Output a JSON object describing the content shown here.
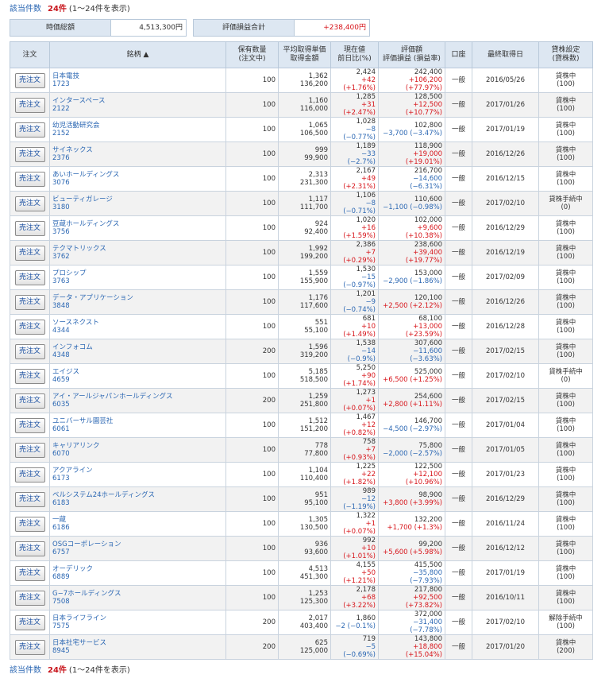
{
  "count": {
    "label": "該当件数",
    "number": "24件",
    "range": "(1～24件を表示)"
  },
  "summary": {
    "market_label": "時価総額",
    "market_value": "4,513,300円",
    "pl_label": "評価損益合計",
    "pl_value": "+238,400円"
  },
  "headers": {
    "order": "注文",
    "name": "銘柄 ▲",
    "qty": [
      "保有数量",
      "(注文中)"
    ],
    "avg": [
      "平均取得単価",
      "取得金額"
    ],
    "cur": [
      "現在値",
      "前日比(%)"
    ],
    "val": [
      "評価額",
      "評価損益 (損益率)"
    ],
    "acct": "口座",
    "date": "最終取得日",
    "lend": [
      "貸株設定",
      "(貸株数)"
    ]
  },
  "order_button_label": "売注文",
  "rows": [
    {
      "name": "日本電技",
      "code": "1723",
      "qty": "100",
      "avg": "1,362",
      "cost": "136,200",
      "price": "2,424",
      "chg": "+42 (+1.76%)",
      "val": "242,400",
      "pl": "+106,200 (+77.97%)",
      "acct": "一般",
      "date": "2016/05/26",
      "lend": "貸株中",
      "lendn": "(100)"
    },
    {
      "name": "インタースペース",
      "code": "2122",
      "qty": "100",
      "avg": "1,160",
      "cost": "116,000",
      "price": "1,285",
      "chg": "+31 (+2.47%)",
      "val": "128,500",
      "pl": "+12,500 (+10.77%)",
      "acct": "一般",
      "date": "2017/01/26",
      "lend": "貸株中",
      "lendn": "(100)"
    },
    {
      "name": "幼児活動研究会",
      "code": "2152",
      "qty": "100",
      "avg": "1,065",
      "cost": "106,500",
      "price": "1,028",
      "chg": "−8 (−0.77%)",
      "val": "102,800",
      "pl": "−3,700 (−3.47%)",
      "acct": "一般",
      "date": "2017/01/19",
      "lend": "貸株中",
      "lendn": "(100)"
    },
    {
      "name": "サイネックス",
      "code": "2376",
      "qty": "100",
      "avg": "999",
      "cost": "99,900",
      "price": "1,189",
      "chg": "−33 (−2.7%)",
      "val": "118,900",
      "pl": "+19,000 (+19.01%)",
      "acct": "一般",
      "date": "2016/12/26",
      "lend": "貸株中",
      "lendn": "(100)"
    },
    {
      "name": "あいホールディングス",
      "code": "3076",
      "qty": "100",
      "avg": "2,313",
      "cost": "231,300",
      "price": "2,167",
      "chg": "+49 (+2.31%)",
      "val": "216,700",
      "pl": "−14,600 (−6.31%)",
      "acct": "一般",
      "date": "2016/12/15",
      "lend": "貸株中",
      "lendn": "(100)"
    },
    {
      "name": "ビューティガレージ",
      "code": "3180",
      "qty": "100",
      "avg": "1,117",
      "cost": "111,700",
      "price": "1,106",
      "chg": "−8 (−0.71%)",
      "val": "110,600",
      "pl": "−1,100 (−0.98%)",
      "acct": "一般",
      "date": "2017/02/10",
      "lend": "貸株手続中",
      "lendn": "(0)"
    },
    {
      "name": "豆蔵ホールディングス",
      "code": "3756",
      "qty": "100",
      "avg": "924",
      "cost": "92,400",
      "price": "1,020",
      "chg": "+16 (+1.59%)",
      "val": "102,000",
      "pl": "+9,600 (+10.38%)",
      "acct": "一般",
      "date": "2016/12/29",
      "lend": "貸株中",
      "lendn": "(100)"
    },
    {
      "name": "テクマトリックス",
      "code": "3762",
      "qty": "100",
      "avg": "1,992",
      "cost": "199,200",
      "price": "2,386",
      "chg": "+7 (+0.29%)",
      "val": "238,600",
      "pl": "+39,400 (+19.77%)",
      "acct": "一般",
      "date": "2016/12/19",
      "lend": "貸株中",
      "lendn": "(100)"
    },
    {
      "name": "プロシップ",
      "code": "3763",
      "qty": "100",
      "avg": "1,559",
      "cost": "155,900",
      "price": "1,530",
      "chg": "−15 (−0.97%)",
      "val": "153,000",
      "pl": "−2,900 (−1.86%)",
      "acct": "一般",
      "date": "2017/02/09",
      "lend": "貸株中",
      "lendn": "(100)"
    },
    {
      "name": "データ・アプリケーション",
      "code": "3848",
      "qty": "100",
      "avg": "1,176",
      "cost": "117,600",
      "price": "1,201",
      "chg": "−9 (−0.74%)",
      "val": "120,100",
      "pl": "+2,500 (+2.12%)",
      "acct": "一般",
      "date": "2016/12/26",
      "lend": "貸株中",
      "lendn": "(100)"
    },
    {
      "name": "ソースネクスト",
      "code": "4344",
      "qty": "100",
      "avg": "551",
      "cost": "55,100",
      "price": "681",
      "chg": "+10 (+1.49%)",
      "val": "68,100",
      "pl": "+13,000 (+23.59%)",
      "acct": "一般",
      "date": "2016/12/28",
      "lend": "貸株中",
      "lendn": "(100)"
    },
    {
      "name": "インフォコム",
      "code": "4348",
      "qty": "200",
      "avg": "1,596",
      "cost": "319,200",
      "price": "1,538",
      "chg": "−14 (−0.9%)",
      "val": "307,600",
      "pl": "−11,600 (−3.63%)",
      "acct": "一般",
      "date": "2017/02/15",
      "lend": "貸株中",
      "lendn": "(100)"
    },
    {
      "name": "エイジス",
      "code": "4659",
      "qty": "100",
      "avg": "5,185",
      "cost": "518,500",
      "price": "5,250",
      "chg": "+90 (+1.74%)",
      "val": "525,000",
      "pl": "+6,500 (+1.25%)",
      "acct": "一般",
      "date": "2017/02/10",
      "lend": "貸株手続中",
      "lendn": "(0)"
    },
    {
      "name": "アイ・アールジャパンホールディングス",
      "code": "6035",
      "qty": "200",
      "avg": "1,259",
      "cost": "251,800",
      "price": "1,273",
      "chg": "+1 (+0.07%)",
      "val": "254,600",
      "pl": "+2,800 (+1.11%)",
      "acct": "一般",
      "date": "2017/02/15",
      "lend": "貸株中",
      "lendn": "(100)"
    },
    {
      "name": "ユニバーサル園芸社",
      "code": "6061",
      "qty": "100",
      "avg": "1,512",
      "cost": "151,200",
      "price": "1,467",
      "chg": "+12 (+0.82%)",
      "val": "146,700",
      "pl": "−4,500 (−2.97%)",
      "acct": "一般",
      "date": "2017/01/04",
      "lend": "貸株中",
      "lendn": "(100)"
    },
    {
      "name": "キャリアリンク",
      "code": "6070",
      "qty": "100",
      "avg": "778",
      "cost": "77,800",
      "price": "758",
      "chg": "+7 (+0.93%)",
      "val": "75,800",
      "pl": "−2,000 (−2.57%)",
      "acct": "一般",
      "date": "2017/01/05",
      "lend": "貸株中",
      "lendn": "(100)"
    },
    {
      "name": "アクアライン",
      "code": "6173",
      "qty": "100",
      "avg": "1,104",
      "cost": "110,400",
      "price": "1,225",
      "chg": "+22 (+1.82%)",
      "val": "122,500",
      "pl": "+12,100 (+10.96%)",
      "acct": "一般",
      "date": "2017/01/23",
      "lend": "貸株中",
      "lendn": "(100)"
    },
    {
      "name": "ベルシステム24ホールディングス",
      "code": "6183",
      "qty": "100",
      "avg": "951",
      "cost": "95,100",
      "price": "989",
      "chg": "−12 (−1.19%)",
      "val": "98,900",
      "pl": "+3,800 (+3.99%)",
      "acct": "一般",
      "date": "2016/12/29",
      "lend": "貸株中",
      "lendn": "(100)"
    },
    {
      "name": "一蔵",
      "code": "6186",
      "qty": "100",
      "avg": "1,305",
      "cost": "130,500",
      "price": "1,322",
      "chg": "+1 (+0.07%)",
      "val": "132,200",
      "pl": "+1,700 (+1.3%)",
      "acct": "一般",
      "date": "2016/11/24",
      "lend": "貸株中",
      "lendn": "(100)"
    },
    {
      "name": "OSGコーポレーション",
      "code": "6757",
      "qty": "100",
      "avg": "936",
      "cost": "93,600",
      "price": "992",
      "chg": "+10 (+1.01%)",
      "val": "99,200",
      "pl": "+5,600 (+5.98%)",
      "acct": "一般",
      "date": "2016/12/12",
      "lend": "貸株中",
      "lendn": "(100)"
    },
    {
      "name": "オーデリック",
      "code": "6889",
      "qty": "100",
      "avg": "4,513",
      "cost": "451,300",
      "price": "4,155",
      "chg": "+50 (+1.21%)",
      "val": "415,500",
      "pl": "−35,800 (−7.93%)",
      "acct": "一般",
      "date": "2017/01/19",
      "lend": "貸株中",
      "lendn": "(100)"
    },
    {
      "name": "G−7ホールディングス",
      "code": "7508",
      "qty": "100",
      "avg": "1,253",
      "cost": "125,300",
      "price": "2,178",
      "chg": "+68 (+3.22%)",
      "val": "217,800",
      "pl": "+92,500 (+73.82%)",
      "acct": "一般",
      "date": "2016/10/11",
      "lend": "貸株中",
      "lendn": "(100)"
    },
    {
      "name": "日本ライフライン",
      "code": "7575",
      "qty": "200",
      "avg": "2,017",
      "cost": "403,400",
      "price": "1,860",
      "chg": "−2 (−0.1%)",
      "val": "372,000",
      "pl": "−31,400 (−7.78%)",
      "acct": "一般",
      "date": "2017/02/10",
      "lend": "解除手続中",
      "lendn": "(100)"
    },
    {
      "name": "日本社宅サービス",
      "code": "8945",
      "qty": "200",
      "avg": "625",
      "cost": "125,000",
      "price": "719",
      "chg": "−5 (−0.69%)",
      "val": "143,800",
      "pl": "+18,800 (+15.04%)",
      "acct": "一般",
      "date": "2017/01/20",
      "lend": "貸株中",
      "lendn": "(200)"
    }
  ],
  "colors": {
    "positive": "#d7141a",
    "negative": "#2b67b3",
    "header_bg": "#dde7f2"
  }
}
